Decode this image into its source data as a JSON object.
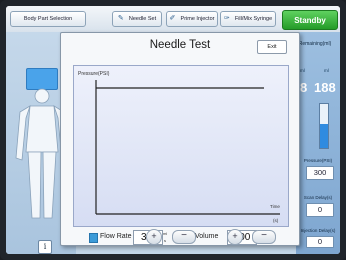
{
  "topbar": {
    "body_part_label": "Body Part Selection",
    "needle_set_label": "Needle Set",
    "prime_line_label": "Prime Injector",
    "fill_mix_label": "Fill/Mix Syringe",
    "standby_label": "Standby"
  },
  "right_panel": {
    "title": "Remaining(ml)",
    "sub_left": "ml",
    "sub_right": "ml",
    "value_left": "8",
    "value_right": "188",
    "gauge_fraction": 0.55,
    "pressure_label": "Pressure(PSI)",
    "pressure_value": "300",
    "scan_delay_label": "Scan Delay(s)",
    "scan_delay_value": "0",
    "injection_delay_label": "Injection Delay(s)",
    "injection_delay_value": "0"
  },
  "dialog": {
    "title": "Needle Test",
    "exit_label": "Exit",
    "ylabel": "Pressure(PSI)",
    "xlabel_top": "Time",
    "xlabel_bottom": "(s)",
    "flow_rate_label": "Flow Rate",
    "flow_rate_value": "3.0",
    "flow_rate_unit_top": "ml",
    "flow_rate_unit_bottom": "s",
    "volume_label": "Volume",
    "volume_value": "100",
    "volume_unit": "mL",
    "plus": "+",
    "minus": "−"
  },
  "left_panel": {
    "info_label": "i"
  },
  "colors": {
    "accent": "#3f9be0",
    "standby": "#2aa52f",
    "chart_bg": "#dfe5f6"
  },
  "chart_data": {
    "type": "line",
    "title": "",
    "xlabel": "Time (s)",
    "ylabel": "Pressure(PSI)",
    "series": [
      {
        "x": [
          0,
          1
        ],
        "y": [
          1,
          1
        ]
      }
    ]
  }
}
